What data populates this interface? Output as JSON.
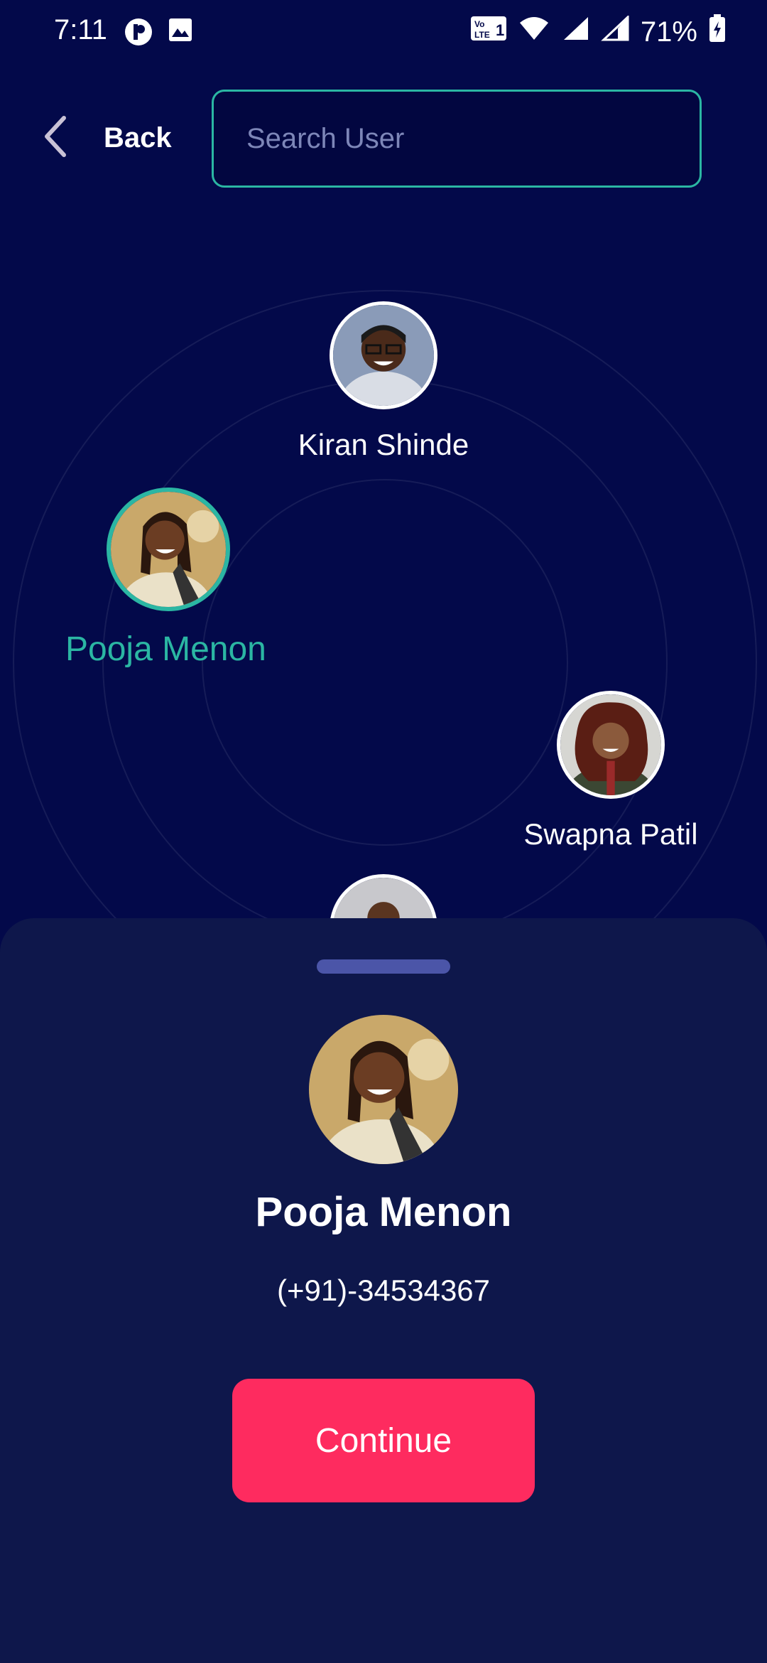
{
  "status_bar": {
    "time": "7:11",
    "battery": "71%",
    "network": "Vo LTE 1"
  },
  "header": {
    "back_label": "Back",
    "search_placeholder": "Search User",
    "search_value": ""
  },
  "colors": {
    "background": "#03094a",
    "sheet": "#0e174b",
    "accent": "#2bb6a3",
    "button": "#fe2b5f"
  },
  "users": [
    {
      "name": "Kiran Shinde",
      "selected": false
    },
    {
      "name": "Pooja Menon",
      "selected": true
    },
    {
      "name": "Swapna Patil",
      "selected": false
    },
    {
      "name": "",
      "selected": false
    }
  ],
  "selected_user": {
    "name": "Pooja Menon",
    "phone": "(+91)-34534367"
  },
  "actions": {
    "continue_label": "Continue"
  }
}
